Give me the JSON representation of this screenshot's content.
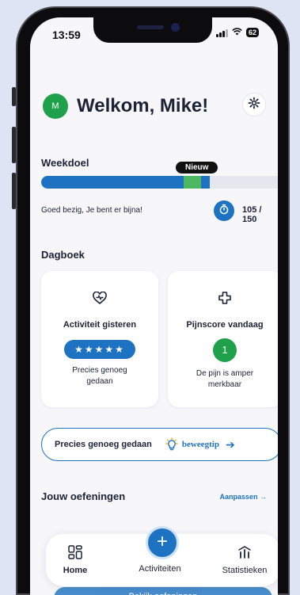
{
  "status_bar": {
    "time": "13:59",
    "battery": "62"
  },
  "header": {
    "avatar_initial": "M",
    "welcome": "Welkom, Mike!"
  },
  "weekdoel": {
    "title": "Weekdoel",
    "badge": "Nieuw",
    "progress": 0.7,
    "message": "Goed bezig, Je bent er bijna!",
    "count": "105 / 150"
  },
  "dagboek": {
    "title": "Dagboek",
    "activity_card": {
      "title": "Activiteit gisteren",
      "stars": "★★★★★",
      "description": "Precies genoeg gedaan"
    },
    "pain_card": {
      "title": "Pijnscore vandaag",
      "score": "1",
      "description": "De pijn is amper merkbaar"
    }
  },
  "tip_banner": {
    "text": "Precies genoeg gedaan",
    "link": "beweegtip"
  },
  "oefeningen": {
    "title": "Jouw oefeningen",
    "link": "Aanpassen →"
  },
  "bottom_nav": {
    "home": "Home",
    "activiteiten": "Activiteiten",
    "statistieken": "Statistieken",
    "fab": "+"
  },
  "bottom_button": "Bekijk oefeningen",
  "colors": {
    "primary": "#1d72c1",
    "success": "#1fa14b",
    "text": "#1c2235"
  }
}
